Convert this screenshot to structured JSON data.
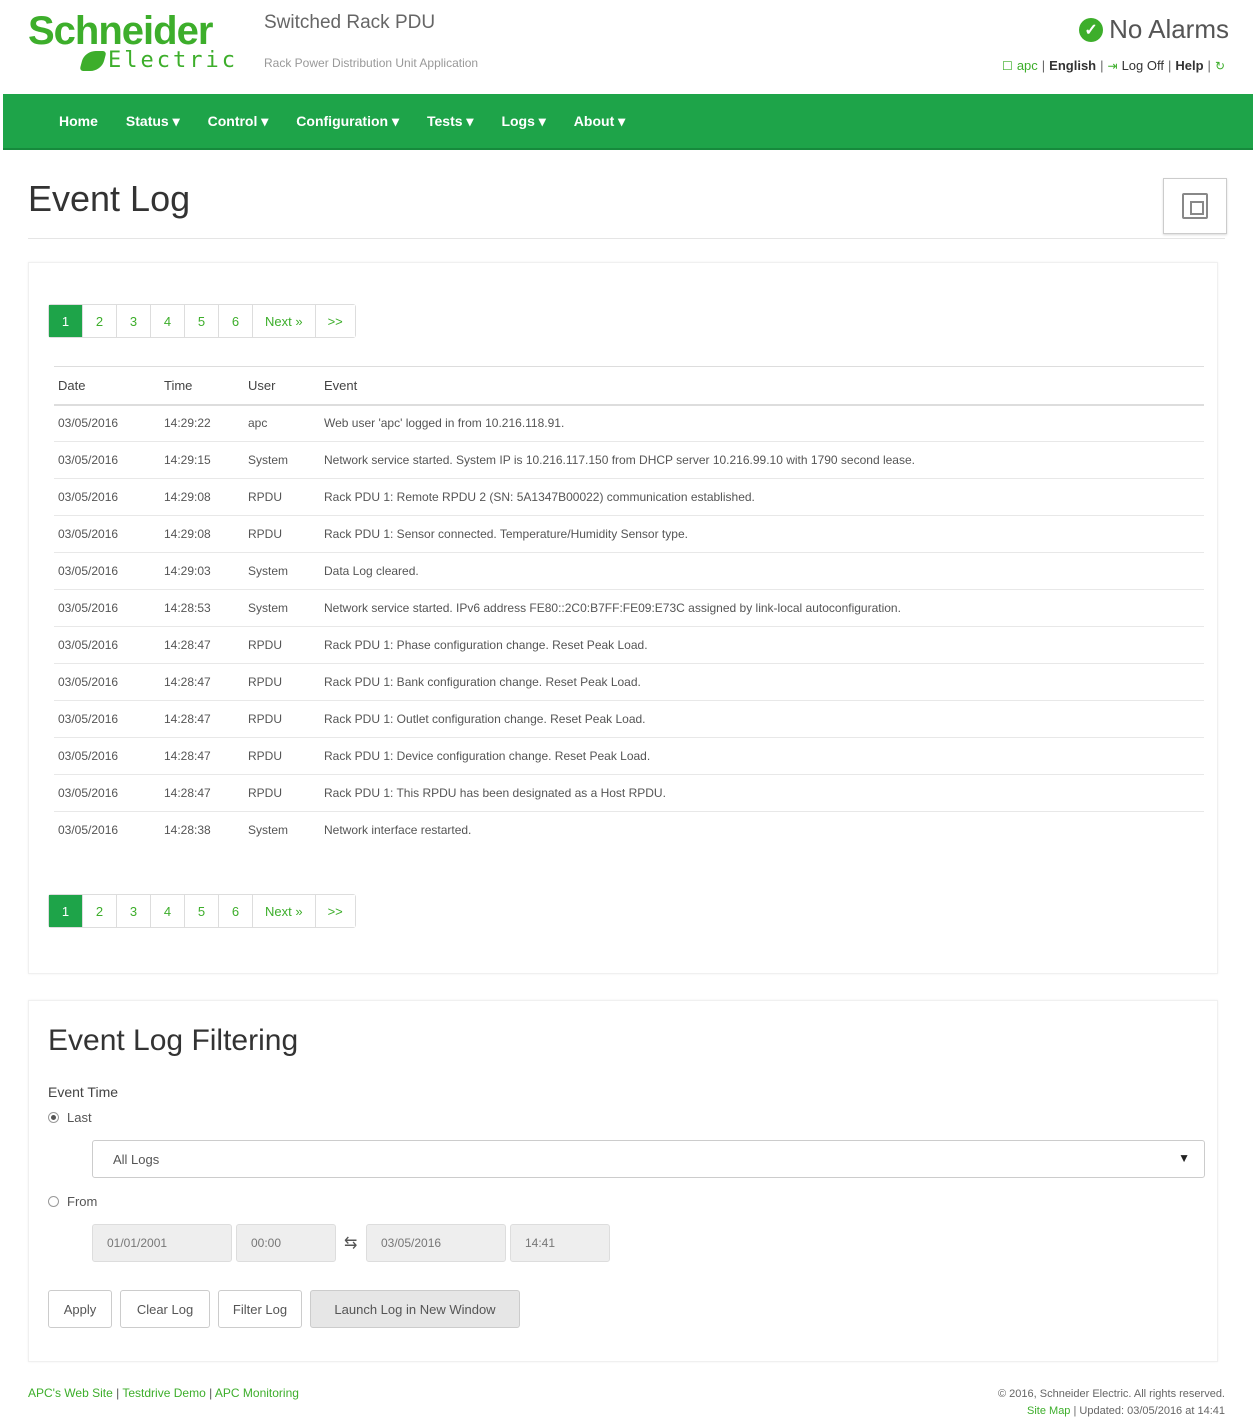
{
  "brand": {
    "name": "Schneider",
    "sub": "Electric",
    "color": "#3dae2b"
  },
  "product": {
    "title": "Switched Rack PDU",
    "subtitle": "Rack Power Distribution Unit Application"
  },
  "alarm": {
    "text": "No Alarms",
    "icon": "check-circle-icon"
  },
  "userbar": {
    "user": "apc",
    "language": "English",
    "logoff": "Log Off",
    "help": "Help"
  },
  "nav": {
    "items": [
      "Home",
      "Status ▾",
      "Control ▾",
      "Configuration ▾",
      "Tests ▾",
      "Logs ▾",
      "About ▾"
    ],
    "color": "#1ea449"
  },
  "page": {
    "title": "Event Log"
  },
  "pagination": {
    "pages": [
      "1",
      "2",
      "3",
      "4",
      "5",
      "6"
    ],
    "next": "Next »",
    "last": ">>",
    "active": "1"
  },
  "table": {
    "headers": [
      "Date",
      "Time",
      "User",
      "Event"
    ],
    "rows": [
      [
        "03/05/2016",
        "14:29:22",
        "apc",
        "Web user 'apc' logged in from 10.216.118.91."
      ],
      [
        "03/05/2016",
        "14:29:15",
        "System",
        "Network service started. System IP is 10.216.117.150 from DHCP server 10.216.99.10 with 1790 second lease."
      ],
      [
        "03/05/2016",
        "14:29:08",
        "RPDU",
        "Rack PDU 1: Remote RPDU 2 (SN: 5A1347B00022) communication established."
      ],
      [
        "03/05/2016",
        "14:29:08",
        "RPDU",
        "Rack PDU 1: Sensor connected. Temperature/Humidity Sensor type."
      ],
      [
        "03/05/2016",
        "14:29:03",
        "System",
        "Data Log cleared."
      ],
      [
        "03/05/2016",
        "14:28:53",
        "System",
        "Network service started. IPv6 address FE80::2C0:B7FF:FE09:E73C assigned by link-local autoconfiguration."
      ],
      [
        "03/05/2016",
        "14:28:47",
        "RPDU",
        "Rack PDU 1: Phase configuration change. Reset Peak Load."
      ],
      [
        "03/05/2016",
        "14:28:47",
        "RPDU",
        "Rack PDU 1: Bank configuration change. Reset Peak Load."
      ],
      [
        "03/05/2016",
        "14:28:47",
        "RPDU",
        "Rack PDU 1: Outlet configuration change. Reset Peak Load."
      ],
      [
        "03/05/2016",
        "14:28:47",
        "RPDU",
        "Rack PDU 1: Device configuration change. Reset Peak Load."
      ],
      [
        "03/05/2016",
        "14:28:47",
        "RPDU",
        "Rack PDU 1: This RPDU has been designated as a Host RPDU."
      ],
      [
        "03/05/2016",
        "14:28:38",
        "System",
        "Network interface restarted."
      ]
    ]
  },
  "filter": {
    "title": "Event Log Filtering",
    "event_time_label": "Event Time",
    "last_label": "Last",
    "last_value": "All Logs",
    "from_label": "From",
    "from_date": "01/01/2001",
    "from_time": "00:00",
    "to_date": "03/05/2016",
    "to_time": "14:41",
    "to_symbol": "⇆",
    "buttons": {
      "apply": "Apply",
      "clear": "Clear Log",
      "filter": "Filter Log",
      "launch": "Launch Log in New Window"
    }
  },
  "footer": {
    "links": [
      "APC's Web Site",
      "Testdrive Demo",
      "APC Monitoring"
    ],
    "copyright": "© 2016, Schneider Electric. All rights reserved.",
    "sitemap": "Site Map",
    "updated": "Updated: 03/05/2016 at 14:41"
  }
}
